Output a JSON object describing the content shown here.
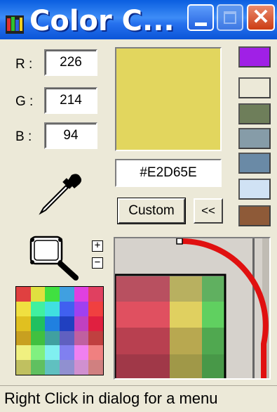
{
  "window": {
    "title": "Color C...",
    "close_glyph": "✕"
  },
  "rgb": {
    "r_label": "R :",
    "g_label": "G :",
    "b_label": "B :",
    "r_value": "226",
    "g_value": "214",
    "b_value": "94"
  },
  "preview": {
    "color": "#E2D65E",
    "hex_text": "#E2D65E"
  },
  "buttons": {
    "custom_label": "Custom",
    "collapse_label": "<<",
    "zoom_in_label": "+",
    "zoom_out_label": "−"
  },
  "swatches": [
    {
      "color": "#A020E6"
    },
    {
      "color": "#ECE9D8"
    },
    {
      "color": "#6E7E5A"
    },
    {
      "color": "#869CA8"
    },
    {
      "color": "#6A8AA6"
    },
    {
      "color": "#D0E2F4"
    },
    {
      "color": "#8E5A38"
    }
  ],
  "icons": {
    "dropper": "eyedropper-icon",
    "magnifier": "magnifier-icon"
  },
  "palette": [
    [
      "#E04040",
      "#E0E040",
      "#40E040",
      "#40A0E0",
      "#E040E0",
      "#E04060"
    ],
    [
      "#F0E040",
      "#40F0A0",
      "#40E0E0",
      "#4060F0",
      "#A040F0",
      "#F04040"
    ],
    [
      "#E0C020",
      "#20C060",
      "#2080E0",
      "#2040C0",
      "#C040C0",
      "#E02040"
    ],
    [
      "#C8A020",
      "#40C040",
      "#40A0A0",
      "#6060C0",
      "#C060A0",
      "#C04040"
    ],
    [
      "#F0F080",
      "#80F080",
      "#80F0F0",
      "#8080F0",
      "#F080F0",
      "#F08080"
    ],
    [
      "#C0C060",
      "#60C060",
      "#60C0C0",
      "#9090D0",
      "#D090D0",
      "#D08080"
    ]
  ],
  "zoom_grid": [
    [
      "#B85060",
      "#B8B060",
      "#60B060"
    ],
    [
      "#E05060",
      "#E0D060",
      "#60D060"
    ],
    [
      "#B84050",
      "#B8A850",
      "#50A850"
    ],
    [
      "#A03848",
      "#A09848",
      "#489848"
    ]
  ],
  "status": {
    "text": "Right Click in dialog for a menu"
  }
}
